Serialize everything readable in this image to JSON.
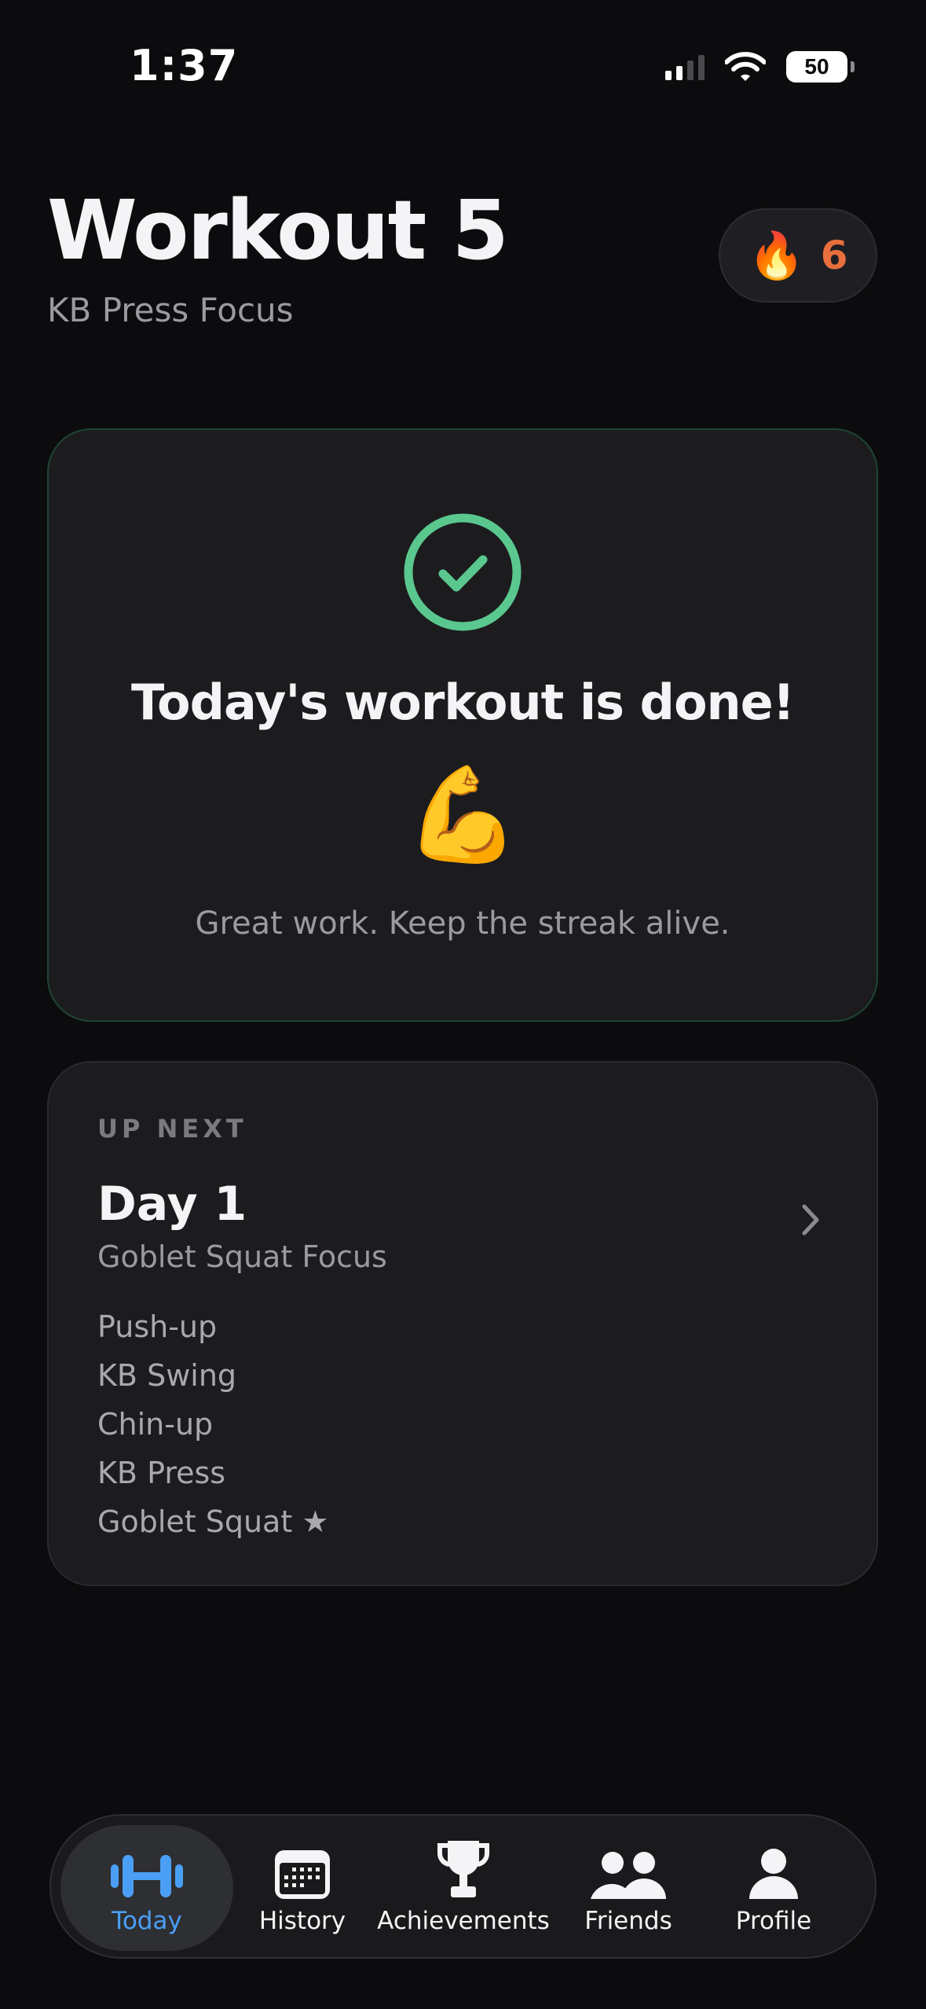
{
  "status_bar": {
    "time": "1:37",
    "battery": "50"
  },
  "header": {
    "title": "Workout 5",
    "subtitle": "KB Press Focus"
  },
  "streak": {
    "icon": "flame-icon",
    "emoji": "🔥",
    "count": "6",
    "color": "#e86f3c"
  },
  "done_card": {
    "icon": "check-circle-icon",
    "title": "Today's workout is done!",
    "emoji": "💪",
    "message": "Great work. Keep the streak alive.",
    "accent": "#5ac88e"
  },
  "next_card": {
    "label": "UP NEXT",
    "day": "Day 1",
    "focus": "Goblet Squat Focus",
    "exercises": [
      "Push-up",
      "KB Swing",
      "Chin-up",
      "KB Press",
      "Goblet Squat ★"
    ]
  },
  "tabs": [
    {
      "label": "Today",
      "icon": "dumbbell-icon",
      "active": true
    },
    {
      "label": "History",
      "icon": "calendar-icon",
      "active": false
    },
    {
      "label": "Achievements",
      "icon": "trophy-icon",
      "active": false
    },
    {
      "label": "Friends",
      "icon": "people-icon",
      "active": false
    },
    {
      "label": "Profile",
      "icon": "person-icon",
      "active": false
    }
  ],
  "colors": {
    "background": "#0c0c0e",
    "card": "#1c1c1f",
    "active_tab": "#4a9ff5"
  }
}
